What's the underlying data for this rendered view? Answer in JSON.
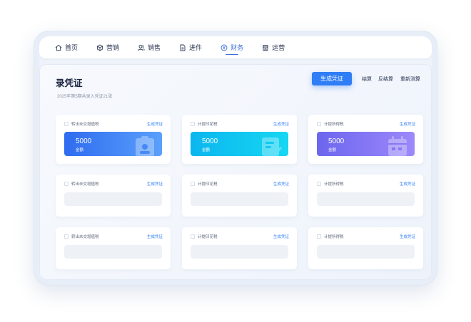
{
  "nav": {
    "items": [
      {
        "label": "首页",
        "icon": "home-icon"
      },
      {
        "label": "营销",
        "icon": "cube-icon"
      },
      {
        "label": "销售",
        "icon": "users-icon"
      },
      {
        "label": "进件",
        "icon": "document-icon"
      },
      {
        "label": "财务",
        "icon": "finance-icon",
        "active": true
      },
      {
        "label": "运营",
        "icon": "store-icon"
      }
    ]
  },
  "page": {
    "title": "录凭证",
    "subtitle": "2025年第5期共录入凭证21张",
    "primary_button": "生成凭证",
    "actions": [
      "结算",
      "反结算",
      "重新测算"
    ]
  },
  "cards": [
    {
      "label": "转出未交增值税",
      "action": "生成凭证",
      "value": "5000",
      "value_label": "金额"
    },
    {
      "label": "计提印花税",
      "action": "生成凭证",
      "value": "5000",
      "value_label": "金额"
    },
    {
      "label": "计提所得税",
      "action": "生成凭证",
      "value": "5000",
      "value_label": "金额"
    },
    {
      "label": "转出未交增值税",
      "action": "生成凭证"
    },
    {
      "label": "计提印花税",
      "action": "生成凭证"
    },
    {
      "label": "计提所得税",
      "action": "生成凭证"
    },
    {
      "label": "转出未交增值税",
      "action": "生成凭证"
    },
    {
      "label": "计提印花税",
      "action": "生成凭证"
    },
    {
      "label": "计提所得税",
      "action": "生成凭证"
    }
  ],
  "colors": {
    "accent": "#2f7ef5",
    "nav_active": "#3e6fd8",
    "stat_blue": "#2f6cf0",
    "stat_cyan": "#0cb6ef",
    "stat_purple": "#6c66ee"
  }
}
